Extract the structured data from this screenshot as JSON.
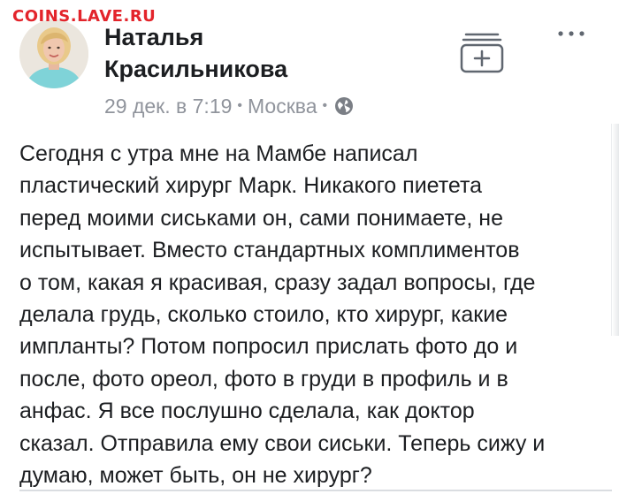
{
  "watermark": "COINS.LAVE.RU",
  "post": {
    "author": {
      "name_line1": "Наталья",
      "name_line2": "Красильникова",
      "avatar": "profile-photo"
    },
    "meta": {
      "date": "29 дек. в 7:19",
      "separator": "•",
      "location": "Москва",
      "privacy_icon": "globe-icon"
    },
    "actions": {
      "save_icon": "save-plus-icon",
      "more_label": "···"
    },
    "text_lines": [
      "Сегодня с утра мне на Мамбе написал",
      "пластический хирург Марк. Никакого пиетета",
      "перед моими сиськами он, сами понимаете, не",
      "испытывает. Вместо стандартных комплиментов",
      "о том, какая я красивая, сразу задал вопросы, где",
      "делала грудь, сколько стоило, кто хирург, какие",
      "импланты? Потом попросил прислать фото до и",
      "после, фото ореол, фото в груди в профиль и в",
      "анфас. Я все послушно сделала, как доктор",
      "сказал. Отправила ему свои сиськи. Теперь сижу и",
      "думаю, может быть, он не хирург?"
    ]
  },
  "colors": {
    "watermark": "#e3242b",
    "text": "#1c1e21",
    "meta": "#90949c",
    "icon": "#606770"
  }
}
